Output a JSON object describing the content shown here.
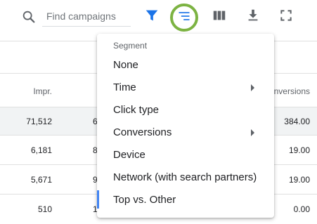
{
  "toolbar": {
    "search_placeholder": "Find campaigns",
    "icons": [
      "search-icon",
      "filter-icon",
      "segment-icon",
      "columns-icon",
      "download-icon",
      "fullscreen-icon"
    ],
    "accent_color": "#1a73e8",
    "highlight_color": "#7cb342"
  },
  "table": {
    "headers": {
      "impr": "Impr.",
      "conversions": "Conversions"
    },
    "rows": [
      {
        "impr": "71,512",
        "clipped": "6",
        "conversions": "384.00"
      },
      {
        "impr": "6,181",
        "clipped": "8",
        "conversions": "19.00"
      },
      {
        "impr": "5,671",
        "clipped": "9",
        "conversions": "19.00"
      },
      {
        "impr": "510",
        "clipped": "1",
        "conversions": "0.00"
      }
    ]
  },
  "segment_menu": {
    "title": "Segment",
    "items": [
      {
        "label": "None",
        "submenu": false
      },
      {
        "label": "Time",
        "submenu": true
      },
      {
        "label": "Click type",
        "submenu": false
      },
      {
        "label": "Conversions",
        "submenu": true
      },
      {
        "label": "Device",
        "submenu": false
      },
      {
        "label": "Network (with search partners)",
        "submenu": false
      },
      {
        "label": "Top vs. Other",
        "submenu": false,
        "selected": true
      }
    ]
  }
}
